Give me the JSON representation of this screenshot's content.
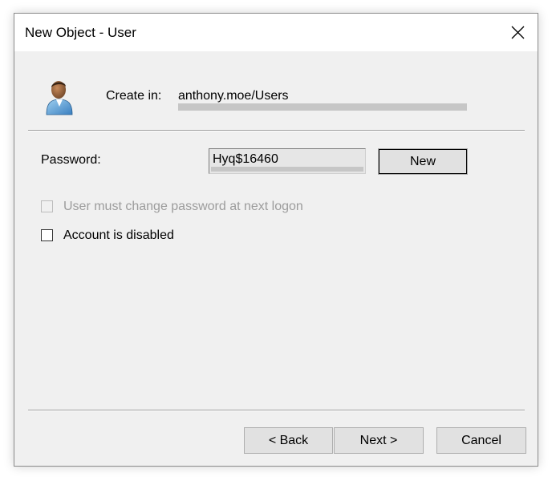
{
  "window": {
    "title": "New Object - User"
  },
  "header": {
    "create_in_label": "Create in:",
    "create_in_value": "anthony.moe/Users",
    "icon": "user-icon"
  },
  "password": {
    "label": "Password:",
    "value": "Hyq$16460",
    "new_button_label": "New"
  },
  "options": [
    {
      "label": "User must change password at next logon",
      "checked": false,
      "enabled": false
    },
    {
      "label": "Account is disabled",
      "checked": false,
      "enabled": true
    }
  ],
  "footer": {
    "back_label": "< Back",
    "next_label": "Next >",
    "cancel_label": "Cancel"
  },
  "colors": {
    "dialog_background": "#f0f0f0",
    "titlebar_background": "#ffffff",
    "button_face": "#e1e1e1",
    "disabled_text": "#9c9c9c"
  }
}
